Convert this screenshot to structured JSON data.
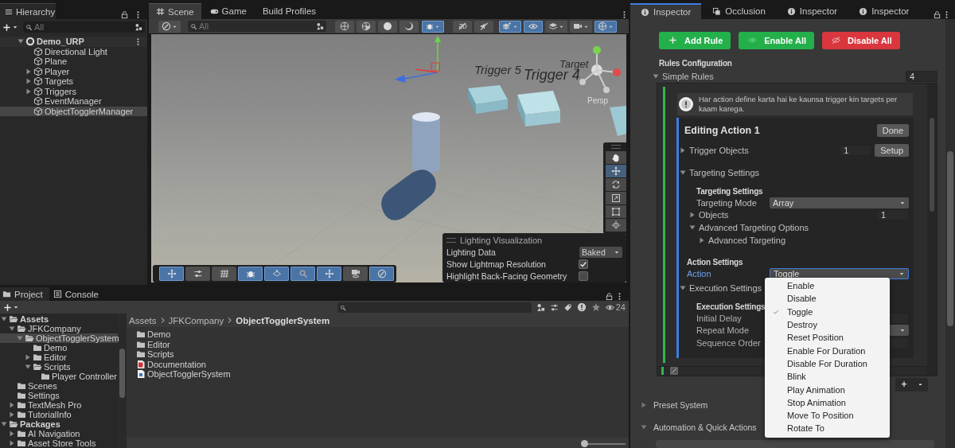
{
  "hierarchy": {
    "tab": {
      "label": "Hierarchy",
      "selected": true
    },
    "search": {
      "placeholder": "All"
    },
    "tree": [
      {
        "label": "Demo_URP",
        "kind": "scene",
        "expanded": true,
        "selected": false,
        "children": [
          {
            "label": "Directional Light",
            "kind": "object",
            "selected": false
          },
          {
            "label": "Plane",
            "kind": "object",
            "selected": false
          },
          {
            "label": "Player",
            "kind": "object",
            "expanded": false,
            "selected": false
          },
          {
            "label": "Targets",
            "kind": "object",
            "expanded": false,
            "selected": false
          },
          {
            "label": "Triggers",
            "kind": "object",
            "expanded": false,
            "selected": false
          },
          {
            "label": "EventManager",
            "kind": "object",
            "selected": false
          },
          {
            "label": "ObjectTogglerManager",
            "kind": "object",
            "selected": true
          }
        ]
      }
    ]
  },
  "scene": {
    "tabs": [
      {
        "label": "Scene",
        "kind": "scene",
        "selected": true
      },
      {
        "label": "Game",
        "kind": "game",
        "selected": false
      },
      {
        "label": "Build Profiles",
        "kind": "plain",
        "selected": false
      }
    ],
    "search": {
      "placeholder": "All"
    },
    "toolbar": [
      {
        "on": false
      },
      {
        "on": false
      },
      {
        "on": false
      },
      {
        "on": false
      },
      {
        "on": true
      },
      {
        "on": false
      },
      {
        "on": false
      },
      {
        "on": true
      },
      {
        "on": true
      },
      {
        "on": false
      },
      {
        "on": false
      },
      {
        "on": true
      }
    ],
    "viewport_labels": [
      "Trigger 5",
      "Trigger 4",
      "Target"
    ],
    "view_mode": "Persp",
    "tool_palette": [
      {
        "selected": false
      },
      {
        "selected": true
      },
      {
        "selected": false
      },
      {
        "selected": false
      },
      {
        "selected": false
      },
      {
        "selected": false
      }
    ],
    "overlay_toolbar": [
      {
        "on": true
      },
      {
        "on": false
      },
      {
        "on": false
      },
      {
        "on": true
      },
      {
        "on": true
      },
      {
        "on": true
      },
      {
        "on": true
      },
      {
        "on": false
      },
      {
        "on": true
      }
    ],
    "lighting": {
      "title": "Lighting Visualization",
      "rows": [
        {
          "label": "Lighting Data",
          "kind": "dropdown",
          "value": "Baked"
        },
        {
          "label": "Show Lightmap Resolution",
          "kind": "checkbox",
          "checked": true
        },
        {
          "label": "Highlight Back-Facing Geometry",
          "kind": "checkbox",
          "checked": false
        }
      ]
    }
  },
  "project": {
    "tabs": [
      {
        "label": "Project",
        "kind": "project",
        "selected": true
      },
      {
        "label": "Console",
        "kind": "console",
        "selected": false
      }
    ],
    "hidden_count": "24",
    "tree": [
      {
        "label": "Assets",
        "kind": "root",
        "expanded": true,
        "selected": false,
        "children": [
          {
            "label": "JFKCompany",
            "kind": "folder",
            "expanded": true,
            "selected": false,
            "children": [
              {
                "label": "ObjectTogglerSystem",
                "kind": "folder",
                "expanded": true,
                "selected": true,
                "children": [
                  {
                    "label": "Demo",
                    "kind": "folder",
                    "selected": false
                  },
                  {
                    "label": "Editor",
                    "kind": "folder",
                    "expanded": false,
                    "selected": false
                  },
                  {
                    "label": "Scripts",
                    "kind": "folder",
                    "expanded": true,
                    "selected": false,
                    "children": [
                      {
                        "label": "Player Controller",
                        "kind": "folder",
                        "selected": false
                      }
                    ]
                  }
                ]
              }
            ]
          },
          {
            "label": "Scenes",
            "kind": "folder",
            "selected": false
          },
          {
            "label": "Settings",
            "kind": "folder",
            "selected": false
          },
          {
            "label": "TextMesh Pro",
            "kind": "folder",
            "expanded": false,
            "selected": false
          },
          {
            "label": "TutorialInfo",
            "kind": "folder",
            "expanded": false,
            "selected": false
          }
        ]
      },
      {
        "label": "Packages",
        "kind": "root",
        "expanded": true,
        "selected": false,
        "children": [
          {
            "label": "AI Navigation",
            "kind": "folder",
            "expanded": false,
            "selected": false
          },
          {
            "label": "Asset Store Tools",
            "kind": "folder",
            "expanded": false,
            "selected": false
          }
        ]
      }
    ],
    "breadcrumb": [
      "Assets",
      "JFKCompany",
      "ObjectTogglerSystem"
    ],
    "files": [
      {
        "label": "Demo",
        "kind": "folder"
      },
      {
        "label": "Editor",
        "kind": "folder"
      },
      {
        "label": "Scripts",
        "kind": "folder"
      },
      {
        "label": "Documentation",
        "kind": "pdf"
      },
      {
        "label": "ObjectTogglerSystem",
        "kind": "script"
      }
    ],
    "zoom_slider": {
      "level": 0
    }
  },
  "inspector": {
    "tabs": [
      {
        "label": "Inspector",
        "kind": "inspector",
        "selected": true
      },
      {
        "label": "Occlusion",
        "kind": "occlusion",
        "selected": false
      },
      {
        "label": "Inspector",
        "kind": "inspector",
        "selected": false
      },
      {
        "label": "Inspector",
        "kind": "inspector",
        "selected": false
      }
    ],
    "actions": [
      {
        "label": "Add Rule",
        "kind": "add"
      },
      {
        "label": "Enable All",
        "kind": "enable"
      },
      {
        "label": "Disable All",
        "kind": "disable"
      }
    ],
    "heading": "Rules Configuration",
    "simple_rules": {
      "label": "Simple Rules",
      "expanded": true,
      "count": "4"
    },
    "info": "Har action define karta hai ke kaunsa trigger kin targets per kaam karega.",
    "editor": {
      "title": "Editing Action 1",
      "done_button": "Done",
      "trigger_objects": {
        "label": "Trigger Objects",
        "expanded": false,
        "value": "1",
        "button": "Setup"
      },
      "targeting": {
        "label": "Targeting Settings",
        "expanded": true,
        "heading": "Targeting Settings",
        "mode": {
          "label": "Targeting Mode",
          "value": "Array"
        },
        "objects": {
          "label": "Objects",
          "expanded": false,
          "value": "1"
        },
        "advanced": {
          "label": "Advanced Targeting Options",
          "expanded": true,
          "children": [
            {
              "label": "Advanced Targeting",
              "expanded": false
            }
          ]
        }
      },
      "action_settings": {
        "heading": "Action Settings",
        "action": {
          "label": "Action",
          "value": "Toggle",
          "focused": true
        }
      },
      "execution": {
        "label": "Execution Settings",
        "expanded": true,
        "heading": "Execution Settings",
        "fields": [
          {
            "label": "Initial Delay",
            "kind": "number"
          },
          {
            "label": "Repeat Mode",
            "kind": "dropdown"
          },
          {
            "label": "Sequence Order",
            "kind": "number"
          }
        ]
      }
    },
    "list_buttons": [
      "+",
      "-"
    ],
    "sections": [
      {
        "label": "Preset System",
        "expanded": false
      },
      {
        "label": "Automation & Quick Actions",
        "expanded": true
      }
    ],
    "action_menu": [
      {
        "label": "Enable",
        "selected": false
      },
      {
        "label": "Disable",
        "selected": false
      },
      {
        "label": "Toggle",
        "selected": true
      },
      {
        "label": "Destroy",
        "selected": false
      },
      {
        "label": "Reset Position",
        "selected": false
      },
      {
        "label": "Enable For Duration",
        "selected": false
      },
      {
        "label": "Disable For Duration",
        "selected": false
      },
      {
        "label": "Blink",
        "selected": false
      },
      {
        "label": "Play Animation",
        "selected": false
      },
      {
        "label": "Stop Animation",
        "selected": false
      },
      {
        "label": "Move To Position",
        "selected": false
      },
      {
        "label": "Rotate To",
        "selected": false
      }
    ]
  }
}
